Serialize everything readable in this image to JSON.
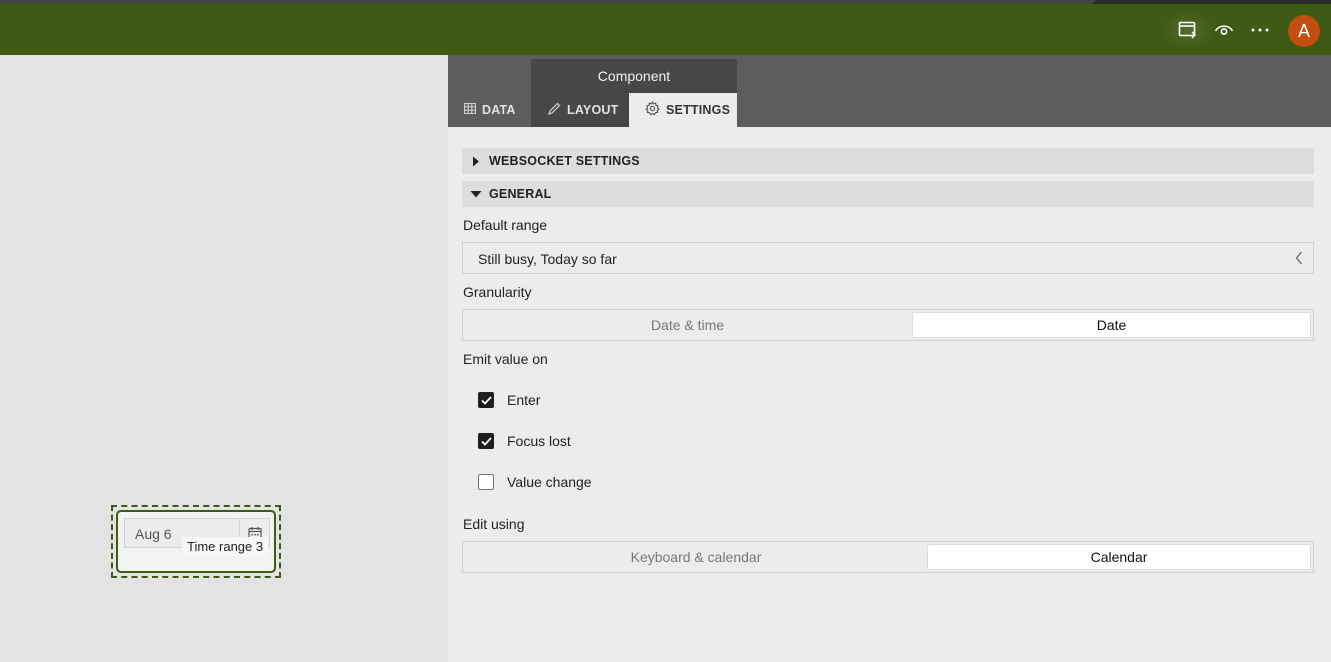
{
  "topbar": {
    "icons": [
      "publish-icon",
      "preview-eye-icon",
      "more-icon"
    ],
    "avatar_letter": "A",
    "colors": {
      "bar": "#3f5a14",
      "avatar": "#c24e10"
    }
  },
  "canvas": {
    "widget": {
      "date_value": "Aug 6",
      "tooltip": "Time range 3"
    }
  },
  "panel": {
    "component_title": "Component",
    "tabs": [
      {
        "label": "DATA",
        "icon": "table-icon"
      },
      {
        "label": "LAYOUT",
        "icon": "pencil-icon"
      },
      {
        "label": "SETTINGS",
        "icon": "gear-icon",
        "active": true
      }
    ],
    "sections": [
      {
        "label": "WEBSOCKET SETTINGS",
        "expanded": false
      },
      {
        "label": "GENERAL",
        "expanded": true
      }
    ],
    "default_range": {
      "label": "Default range",
      "value": "Still busy, Today so far"
    },
    "granularity": {
      "label": "Granularity",
      "options": [
        "Date & time",
        "Date"
      ],
      "selected": "Date"
    },
    "emit_value_on": {
      "label": "Emit value on",
      "options": [
        {
          "label": "Enter",
          "checked": true
        },
        {
          "label": "Focus lost",
          "checked": true
        },
        {
          "label": "Value change",
          "checked": false
        }
      ]
    },
    "edit_using": {
      "label": "Edit using",
      "options": [
        "Keyboard & calendar",
        "Calendar"
      ],
      "selected": "Calendar"
    }
  }
}
